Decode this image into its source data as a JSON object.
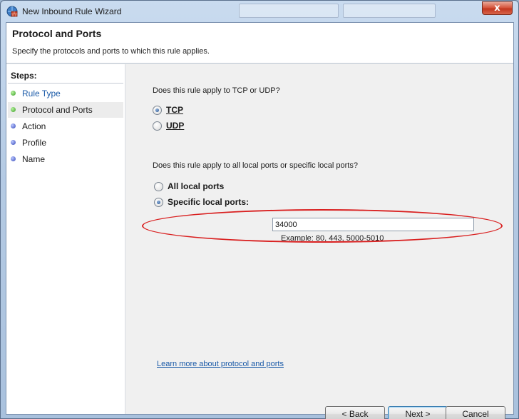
{
  "window": {
    "title": "New Inbound Rule Wizard",
    "close_symbol": "x",
    "icon": "firewall-icon"
  },
  "header": {
    "title": "Protocol and Ports",
    "subtitle": "Specify the protocols and ports to which this rule applies."
  },
  "steps": {
    "heading": "Steps:",
    "items": [
      {
        "label": "Rule Type",
        "state": "done"
      },
      {
        "label": "Protocol and Ports",
        "state": "current"
      },
      {
        "label": "Action",
        "state": "pending"
      },
      {
        "label": "Profile",
        "state": "pending"
      },
      {
        "label": "Name",
        "state": "pending"
      }
    ]
  },
  "protocol": {
    "question": "Does this rule apply to TCP or UDP?",
    "options": [
      {
        "label": "TCP",
        "checked": true
      },
      {
        "label": "UDP",
        "checked": false
      }
    ]
  },
  "ports": {
    "question": "Does this rule apply to all local ports or specific local ports?",
    "all_label": "All local ports",
    "specific_label": "Specific local ports:",
    "selected": "specific",
    "value": "34000",
    "example": "Example: 80, 443, 5000-5010"
  },
  "learn_more": "Learn more about protocol and ports",
  "buttons": {
    "back": "< Back",
    "next": "Next >",
    "cancel": "Cancel"
  },
  "colors": {
    "highlight": "#d92020",
    "link": "#1a5aa8",
    "step_done": "#3b9d27",
    "step_pending": "#3548b8"
  }
}
